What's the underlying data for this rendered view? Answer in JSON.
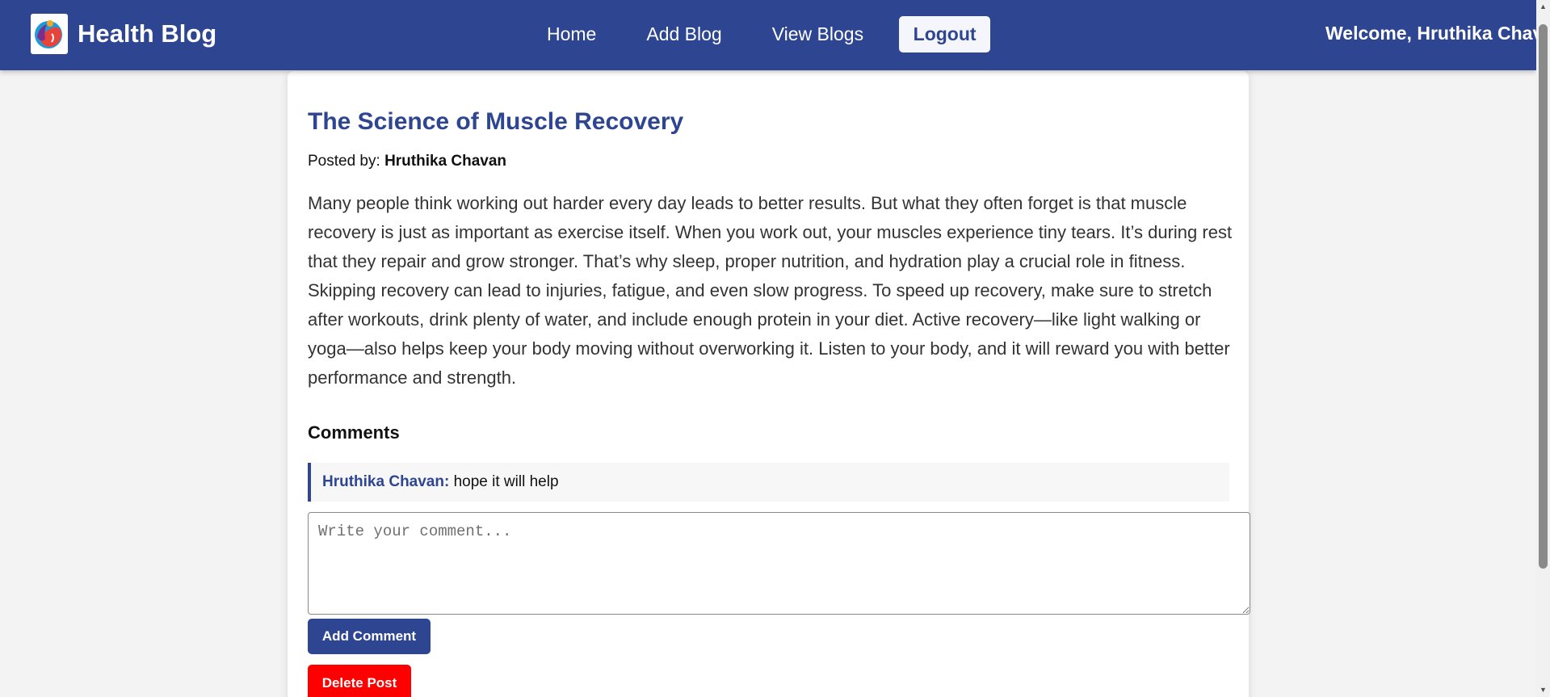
{
  "navbar": {
    "brand_title": "Health Blog",
    "logo_icon": "health-logo-icon",
    "links": [
      {
        "label": "Home"
      },
      {
        "label": "Add Blog"
      },
      {
        "label": "View Blogs"
      }
    ],
    "logout_label": "Logout",
    "welcome_text": "Welcome, Hruthika Chavan"
  },
  "post": {
    "title": "The Science of Muscle Recovery",
    "posted_by_label": "Posted by:",
    "author": "Hruthika Chavan",
    "body": "Many people think working out harder every day leads to better results. But what they often forget is that muscle recovery is just as important as exercise itself. When you work out, your muscles experience tiny tears. It’s during rest that they repair and grow stronger. That’s why sleep, proper nutrition, and hydration play a crucial role in fitness. Skipping recovery can lead to injuries, fatigue, and even slow progress. To speed up recovery, make sure to stretch after workouts, drink plenty of water, and include enough protein in your diet. Active recovery—like light walking or yoga—also helps keep your body moving without overworking it. Listen to your body, and it will reward you with better performance and strength."
  },
  "comments": {
    "heading": "Comments",
    "items": [
      {
        "author": "Hruthika Chavan:",
        "text": "hope it will help"
      }
    ],
    "input_placeholder": "Write your comment...",
    "add_label": "Add Comment",
    "delete_label": "Delete Post"
  },
  "colors": {
    "brand": "#2e4592",
    "danger": "#ff0000",
    "page_bg": "#f3f3f3"
  }
}
